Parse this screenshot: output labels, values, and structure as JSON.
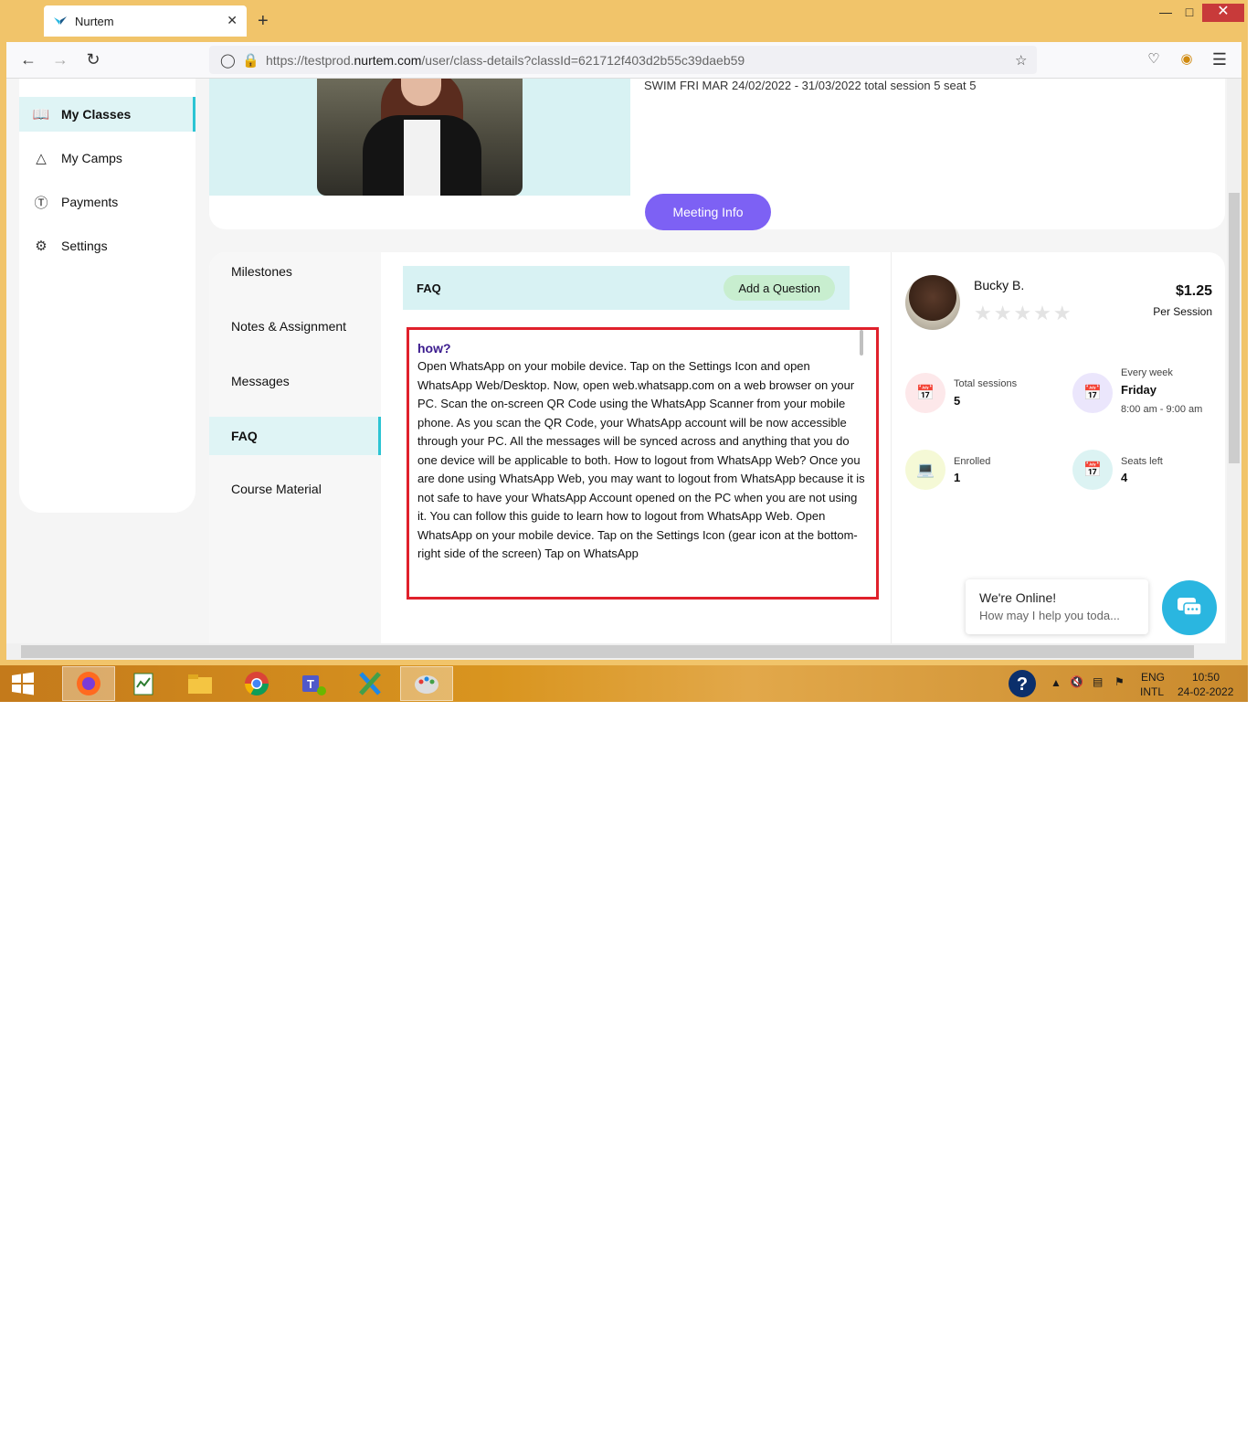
{
  "browser": {
    "tab_title": "Nurtem",
    "tab_close": "✕",
    "new_tab": "+",
    "url_prefix": "https://testprod.",
    "url_host": "nurtem.com",
    "url_path": "/user/class-details?classId=621712f403d2b55c39daeb59"
  },
  "sidebar": {
    "items": [
      {
        "label": "My Classes",
        "icon": "book-icon"
      },
      {
        "label": "My Camps",
        "icon": "tent-icon"
      },
      {
        "label": "Payments",
        "icon": "dollar-icon"
      },
      {
        "label": "Settings",
        "icon": "gear-icon"
      }
    ]
  },
  "class": {
    "session_info": "SWIM FRI MAR 24/02/2022 - 31/03/2022 total session 5 seat 5",
    "meeting_button": "Meeting Info"
  },
  "tabs": {
    "items": [
      "Milestones",
      "Notes & Assignment",
      "Messages",
      "FAQ",
      "Course Material"
    ],
    "active": "FAQ"
  },
  "faq": {
    "header": "FAQ",
    "add_button": "Add a Question",
    "question": "how?",
    "answer": "Open WhatsApp on your mobile device. Tap on the Settings Icon and open WhatsApp Web/Desktop. Now, open web.whatsapp.com on a web browser on your PC. Scan the on-screen QR Code using the WhatsApp Scanner from your mobile phone. As you scan the QR Code, your WhatsApp account will be now accessible through your PC. All the messages will be synced across and anything that you do one device will be applicable to both. How to logout from WhatsApp Web? Once you are done using WhatsApp Web, you may want to logout from WhatsApp because it is not safe to have your WhatsApp Account opened on the PC when you are not using it. You can follow this guide to learn how to logout from WhatsApp Web. Open WhatsApp on your mobile device. Tap on the Settings Icon (gear icon at the bottom-right side of the screen) Tap on WhatsApp"
  },
  "tutor": {
    "name": "Bucky B.",
    "rating_stars": "★★★★★",
    "price": "$1.25",
    "price_unit": "Per Session",
    "total_sessions_label": "Total sessions",
    "total_sessions_value": "5",
    "schedule_label": "Every week",
    "schedule_day": "Friday",
    "schedule_time": "8:00 am - 9:00 am",
    "enrolled_label": "Enrolled",
    "enrolled_value": "1",
    "seats_label": "Seats left",
    "seats_value": "4"
  },
  "chat": {
    "title": "We're Online!",
    "subtitle": "How may I help you toda..."
  },
  "taskbar": {
    "lang": "ENG",
    "layout": "INTL",
    "time": "10:50",
    "date": "24-02-2022"
  },
  "colors": {
    "accent": "#7d61f4",
    "teal": "#2cc4d3",
    "highlight_border": "#e0202b",
    "faq_question": "#3b1b8e"
  }
}
